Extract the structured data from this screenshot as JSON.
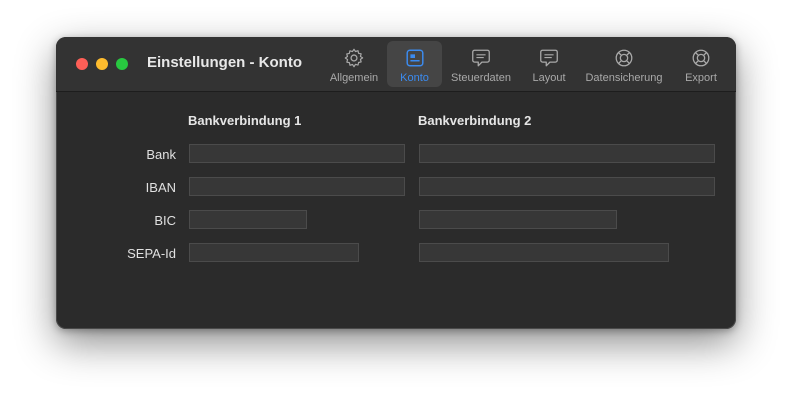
{
  "window": {
    "title": "Einstellungen - Konto"
  },
  "toolbar": {
    "items": [
      {
        "label": "Allgemein",
        "icon": "gear-icon",
        "active": false
      },
      {
        "label": "Konto",
        "icon": "account-card-icon",
        "active": true
      },
      {
        "label": "Steuerdaten",
        "icon": "speech-bubble-icon",
        "active": false
      },
      {
        "label": "Layout",
        "icon": "speech-bubble-icon",
        "active": false
      },
      {
        "label": "Datensicherung",
        "icon": "lifebuoy-icon",
        "active": false
      },
      {
        "label": "Export",
        "icon": "lifebuoy-icon",
        "active": false
      }
    ],
    "active_color": "#3b8bf0"
  },
  "form": {
    "column1": "Bankverbindung 1",
    "column2": "Bankverbindung 2",
    "rows": [
      {
        "label": "Bank",
        "value1": "",
        "value2": ""
      },
      {
        "label": "IBAN",
        "value1": "",
        "value2": ""
      },
      {
        "label": "BIC",
        "value1": "",
        "value2": ""
      },
      {
        "label": "SEPA-Id",
        "value1": "",
        "value2": ""
      }
    ]
  }
}
